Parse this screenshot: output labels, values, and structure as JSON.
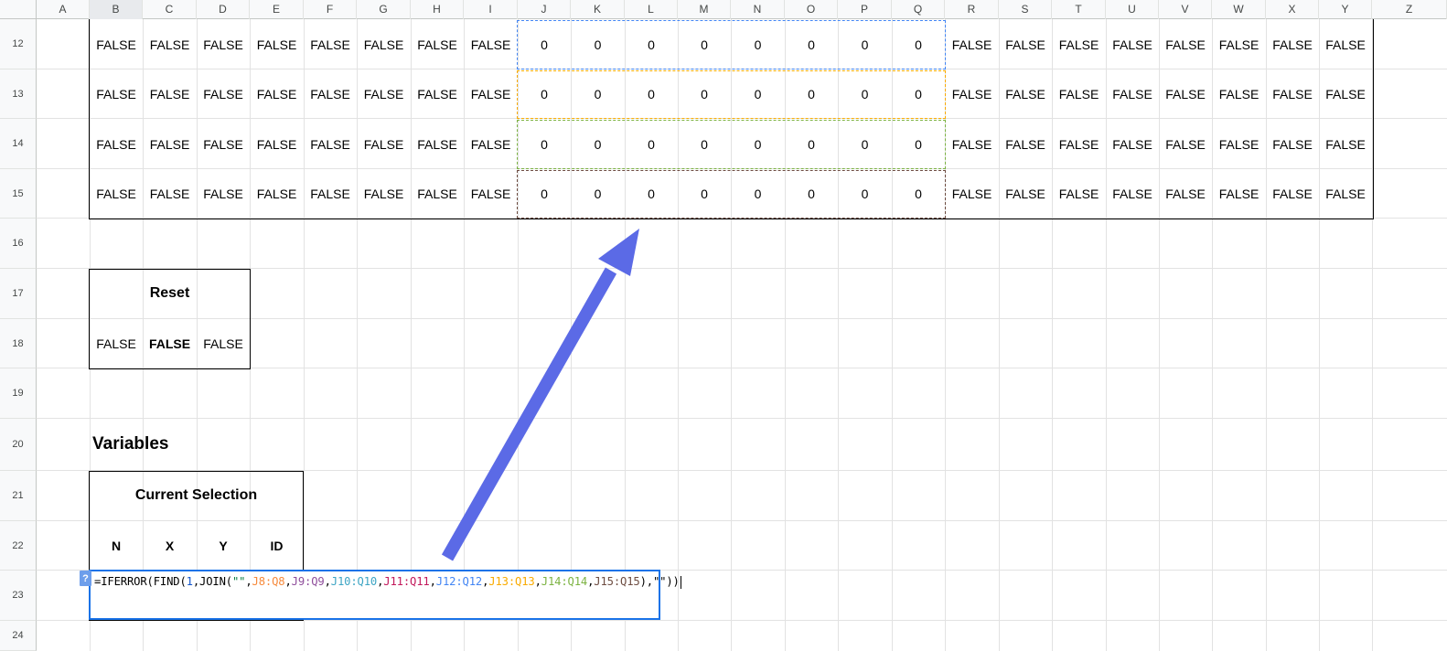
{
  "columns": [
    "A",
    "B",
    "C",
    "D",
    "E",
    "F",
    "G",
    "H",
    "I",
    "J",
    "K",
    "L",
    "M",
    "N",
    "O",
    "P",
    "Q",
    "R",
    "S",
    "T",
    "U",
    "V",
    "W",
    "X",
    "Y",
    "Z"
  ],
  "selected_column": "B",
  "rows": [
    "12",
    "13",
    "14",
    "15",
    "16",
    "17",
    "18",
    "19",
    "20",
    "21",
    "22",
    "23",
    "24"
  ],
  "grid_values": {
    "row12": [
      "FALSE",
      "FALSE",
      "FALSE",
      "FALSE",
      "FALSE",
      "FALSE",
      "FALSE",
      "FALSE",
      "0",
      "0",
      "0",
      "0",
      "0",
      "0",
      "0",
      "0",
      "FALSE",
      "FALSE",
      "FALSE",
      "FALSE",
      "FALSE",
      "FALSE",
      "FALSE",
      "FALSE"
    ],
    "row13": [
      "FALSE",
      "FALSE",
      "FALSE",
      "FALSE",
      "FALSE",
      "FALSE",
      "FALSE",
      "FALSE",
      "0",
      "0",
      "0",
      "0",
      "0",
      "0",
      "0",
      "0",
      "FALSE",
      "FALSE",
      "FALSE",
      "FALSE",
      "FALSE",
      "FALSE",
      "FALSE",
      "FALSE"
    ],
    "row14": [
      "FALSE",
      "FALSE",
      "FALSE",
      "FALSE",
      "FALSE",
      "FALSE",
      "FALSE",
      "FALSE",
      "0",
      "0",
      "0",
      "0",
      "0",
      "0",
      "0",
      "0",
      "FALSE",
      "FALSE",
      "FALSE",
      "FALSE",
      "FALSE",
      "FALSE",
      "FALSE",
      "FALSE"
    ],
    "row15": [
      "FALSE",
      "FALSE",
      "FALSE",
      "FALSE",
      "FALSE",
      "FALSE",
      "FALSE",
      "FALSE",
      "0",
      "0",
      "0",
      "0",
      "0",
      "0",
      "0",
      "0",
      "FALSE",
      "FALSE",
      "FALSE",
      "FALSE",
      "FALSE",
      "FALSE",
      "FALSE",
      "FALSE"
    ]
  },
  "reset": {
    "title": "Reset",
    "values": [
      "FALSE",
      "FALSE",
      "FALSE"
    ]
  },
  "variables": {
    "title": "Variables",
    "current_selection": {
      "title": "Current Selection",
      "headers": [
        "N",
        "X",
        "Y",
        "ID"
      ]
    }
  },
  "formula_editor": {
    "help_badge": "?",
    "tokens": [
      {
        "text": "=IFERROR(FIND(",
        "color": "#000000"
      },
      {
        "text": "1",
        "color": "#1155cc"
      },
      {
        "text": ",JOIN(",
        "color": "#000000"
      },
      {
        "text": "\"\"",
        "color": "#0b8043"
      },
      {
        "text": ",",
        "color": "#000000"
      },
      {
        "text": "J8:Q8",
        "color": "#f6893b"
      },
      {
        "text": ",",
        "color": "#000000"
      },
      {
        "text": "J9:Q9",
        "color": "#8e4d9b"
      },
      {
        "text": ",",
        "color": "#000000"
      },
      {
        "text": "J10:Q10",
        "color": "#3da5c4"
      },
      {
        "text": ",",
        "color": "#000000"
      },
      {
        "text": "J11:Q11",
        "color": "#c2185b"
      },
      {
        "text": ",",
        "color": "#000000"
      },
      {
        "text": "J12:Q12",
        "color": "#4285f4"
      },
      {
        "text": ",",
        "color": "#000000"
      },
      {
        "text": "J13:Q13",
        "color": "#f9ab00"
      },
      {
        "text": ",",
        "color": "#000000"
      },
      {
        "text": "J14:Q14",
        "color": "#7cb342"
      },
      {
        "text": ",",
        "color": "#000000"
      },
      {
        "text": "J15:Q15",
        "color": "#6d4c41"
      },
      {
        "text": "),\"\"))",
        "color": "#000000"
      }
    ]
  },
  "range_highlight_colors": {
    "J12:Q12": "#4285f4",
    "J13:Q13": "#f9ab00",
    "J14:Q14": "#7cb342",
    "J15:Q15": "#6d4c41"
  },
  "annotation_arrow_color": "#5b6ae6"
}
